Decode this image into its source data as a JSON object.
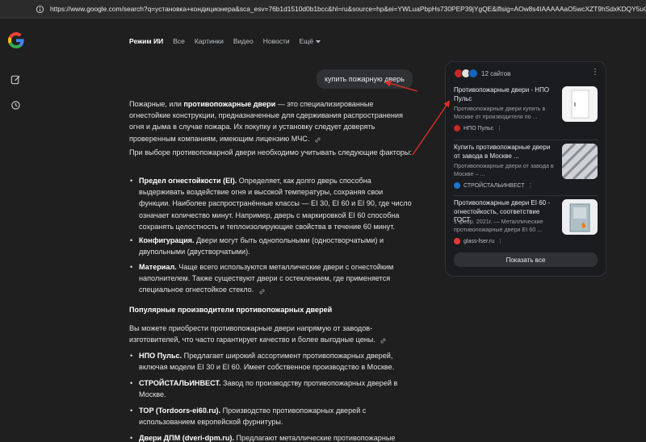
{
  "browser": {
    "url": "https://www.google.com/search?q=установка+кондиционера&sca_esv=76b1d1510d0b1bcc&hl=ru&source=hp&ei=YWLuaPbpHs730PEP39jYgQE&iflsig=AOw8s4IAAAAAaO5wcXZT9hSdxKDQY5uCdWMzC5tzEpLx&aep=22&"
  },
  "colors": {
    "accent_red": "#d93025",
    "bg": "#1f1f1f",
    "card": "#1b1c1f"
  },
  "rail": {
    "logo": "google-g-logo",
    "icons": [
      "new-chat-icon",
      "history-icon"
    ]
  },
  "tabs": [
    {
      "label": "Режим ИИ",
      "active": true
    },
    {
      "label": "Все"
    },
    {
      "label": "Картинки"
    },
    {
      "label": "Видео"
    },
    {
      "label": "Новости"
    },
    {
      "label": "Ещё"
    }
  ],
  "query": "купить пожарную дверь",
  "answer": {
    "p1_a": "Пожарные, или ",
    "p1_bold": "противопожарные двери",
    "p1_b": " — это специализированные огнестойкие конструкции, предназначенные для сдерживания распространения огня и дыма в случае пожара. Их покупку и установку следует доверять проверенным компаниям, имеющим лицензию МЧС.",
    "p2": "При выборе противопожарной двери необходимо учитывать следующие факторы:",
    "factors": [
      {
        "bold": "Предел огнестойкости (EI).",
        "text": " Определяет, как долго дверь способна выдерживать воздействие огня и высокой температуры, сохраняя свои функции. Наиболее распространённые классы — EI 30, EI 60 и EI 90, где число означает количество минут. Например, дверь с маркировкой EI 60 способна сохранять целостность и теплоизолирующие свойства в течение 60 минут."
      },
      {
        "bold": "Конфигурация.",
        "text": " Двери могут быть однопольными (одностворчатыми) и двупольными (двустворчатыми)."
      },
      {
        "bold": "Материал.",
        "text": " Чаще всего используются металлические двери с огнестойким наполнителем. Также существуют двери с остеклением, где применяется специальное огнестойкое стекло."
      }
    ],
    "section_title": "Популярные производители противопожарных дверей",
    "p3": "Вы можете приобрести противопожарные двери напрямую от заводов-изготовителей, что часто гарантирует качество и более выгодные цены.",
    "makers": [
      {
        "bold": "НПО Пульс.",
        "text": " Предлагает широкий ассортимент противопожарных дверей, включая модели EI 30 и EI 60. Имеет собственное производство в Москве."
      },
      {
        "bold": "СТРОЙСТАЛЬИНВЕСТ.",
        "text": " Завод по производству противопожарных дверей в Москве."
      },
      {
        "bold": "TOP (Tordoors-ei60.ru).",
        "text": " Производство противопожарных дверей с использованием европейской фурнитуры."
      },
      {
        "bold": "Двери ДПМ (dveri-dpm.ru).",
        "text": " Предлагают металлические противопожарные двери"
      }
    ]
  },
  "sources": {
    "count_label": "12 сайтов",
    "items": [
      {
        "title": "Противопожарные двери - НПО Пульс",
        "snippet": "Противопожарные двери купить в Москве от производителя по ...",
        "site": "НПО Пульс"
      },
      {
        "title": "Купить противопожарные двери от завода в Москве ...",
        "snippet": "Противопожарные двери от завода в Москве – ...",
        "site": "СТРОЙСТАЛЬИНВЕСТ"
      },
      {
        "title": "Противопожарные двери EI 60 - огнестойкость, соответствие ГОСТ",
        "snippet": "1 февр. 2021г. — Металлические противопожарные двери EI 60 ...",
        "site": "glass-fser.ru"
      }
    ],
    "show_all_label": "Показать все"
  }
}
